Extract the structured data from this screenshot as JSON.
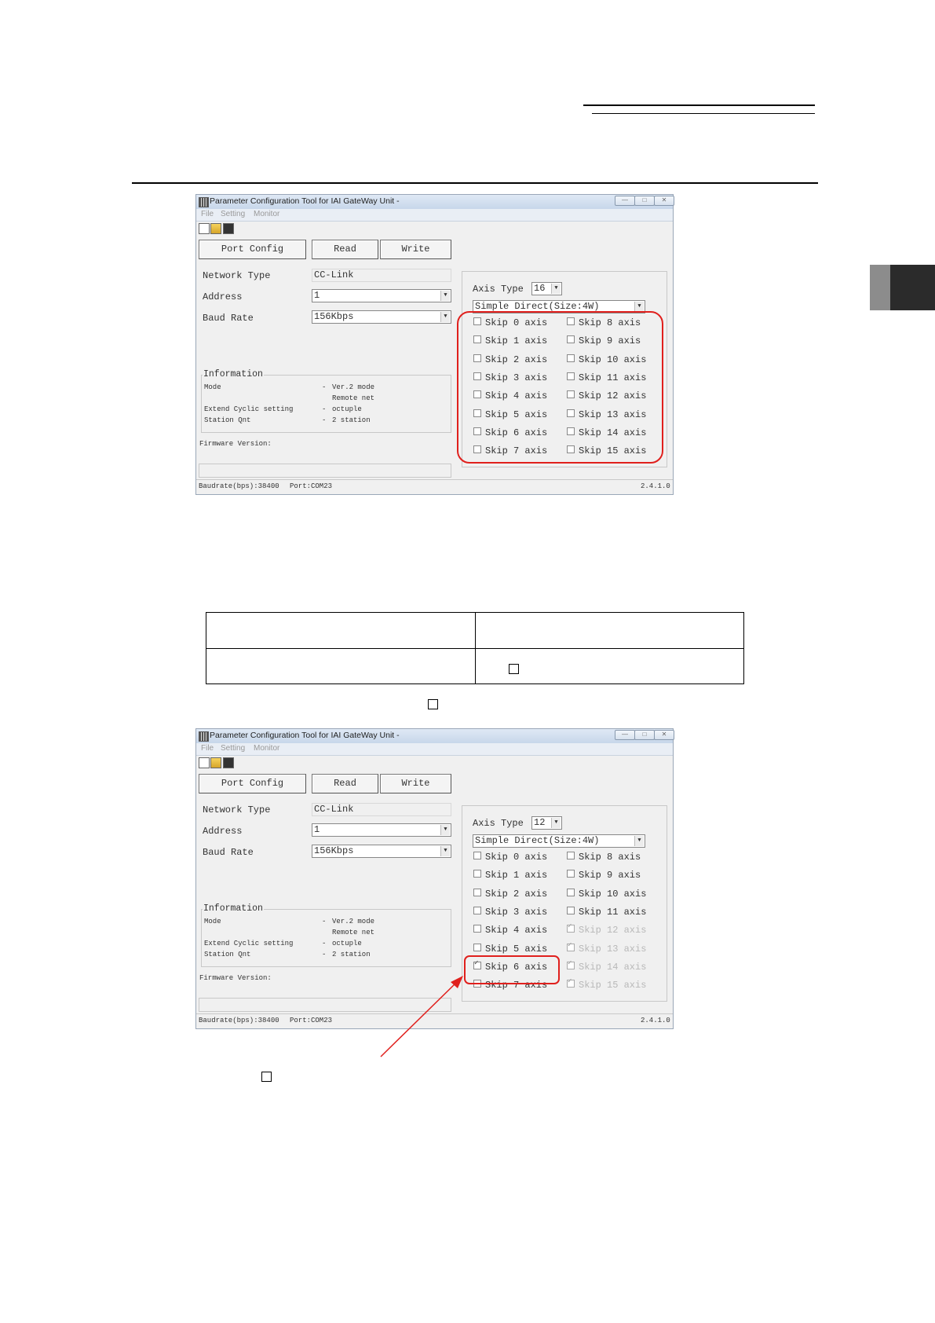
{
  "windows": [
    {
      "title": "Parameter Configuration Tool for IAI GateWay Unit -",
      "window_controls": [
        "minimize-icon",
        "maximize-icon",
        "close-icon"
      ],
      "menu": [
        "File",
        "Setting",
        "Monitor"
      ],
      "toolbar_icons": [
        "new-file-icon",
        "open-folder-icon",
        "save-icon"
      ],
      "buttons": {
        "port_config": "Port Config",
        "read": "Read",
        "write": "Write"
      },
      "network_type_label": "Network Type",
      "network_type_value": "CC-Link",
      "address_label": "Address",
      "address_value": "1",
      "baud_rate_label": "Baud Rate",
      "baud_rate_value": "156Kbps",
      "information": {
        "title": "Information",
        "rows": [
          {
            "label": "Mode",
            "dash": "-",
            "value": "Ver.2 mode"
          },
          {
            "label": "",
            "dash": "",
            "value": "Remote net"
          },
          {
            "label": "Extend Cyclic setting",
            "dash": "-",
            "value": "octuple"
          },
          {
            "label": "Station Qnt",
            "dash": "-",
            "value": "2 station"
          }
        ]
      },
      "firmware_label": "Firmware Version:",
      "axis_type_label": "Axis Type",
      "axis_type_value": "16",
      "mode_value": "Simple Direct(Size:4W)",
      "skip_axes": [
        {
          "label": "Skip 0 axis",
          "checked": false,
          "disabled": false
        },
        {
          "label": "Skip 1 axis",
          "checked": false,
          "disabled": false
        },
        {
          "label": "Skip 2 axis",
          "checked": false,
          "disabled": false
        },
        {
          "label": "Skip 3 axis",
          "checked": false,
          "disabled": false
        },
        {
          "label": "Skip 4 axis",
          "checked": false,
          "disabled": false
        },
        {
          "label": "Skip 5 axis",
          "checked": false,
          "disabled": false
        },
        {
          "label": "Skip 6 axis",
          "checked": false,
          "disabled": false
        },
        {
          "label": "Skip 7 axis",
          "checked": false,
          "disabled": false
        },
        {
          "label": "Skip 8 axis",
          "checked": false,
          "disabled": false
        },
        {
          "label": "Skip 9 axis",
          "checked": false,
          "disabled": false
        },
        {
          "label": "Skip 10 axis",
          "checked": false,
          "disabled": false
        },
        {
          "label": "Skip 11 axis",
          "checked": false,
          "disabled": false
        },
        {
          "label": "Skip 12 axis",
          "checked": false,
          "disabled": false
        },
        {
          "label": "Skip 13 axis",
          "checked": false,
          "disabled": false
        },
        {
          "label": "Skip 14 axis",
          "checked": false,
          "disabled": false
        },
        {
          "label": "Skip 15 axis",
          "checked": false,
          "disabled": false
        }
      ],
      "status_baudrate": "Baudrate(bps):38400",
      "status_port": "Port:COM23",
      "status_version": "2.4.1.0"
    },
    {
      "title": "Parameter Configuration Tool for IAI GateWay Unit -",
      "window_controls": [
        "minimize-icon",
        "maximize-icon",
        "close-icon"
      ],
      "menu": [
        "File",
        "Setting",
        "Monitor"
      ],
      "toolbar_icons": [
        "new-file-icon",
        "open-folder-icon",
        "save-icon"
      ],
      "buttons": {
        "port_config": "Port Config",
        "read": "Read",
        "write": "Write"
      },
      "network_type_label": "Network Type",
      "network_type_value": "CC-Link",
      "address_label": "Address",
      "address_value": "1",
      "baud_rate_label": "Baud Rate",
      "baud_rate_value": "156Kbps",
      "information": {
        "title": "Information",
        "rows": [
          {
            "label": "Mode",
            "dash": "-",
            "value": "Ver.2 mode"
          },
          {
            "label": "",
            "dash": "",
            "value": "Remote net"
          },
          {
            "label": "Extend Cyclic setting",
            "dash": "-",
            "value": "octuple"
          },
          {
            "label": "Station Qnt",
            "dash": "-",
            "value": "2 station"
          }
        ]
      },
      "firmware_label": "Firmware Version:",
      "axis_type_label": "Axis Type",
      "axis_type_value": "12",
      "mode_value": "Simple Direct(Size:4W)",
      "skip_axes": [
        {
          "label": "Skip 0 axis",
          "checked": false,
          "disabled": false
        },
        {
          "label": "Skip 1 axis",
          "checked": false,
          "disabled": false
        },
        {
          "label": "Skip 2 axis",
          "checked": false,
          "disabled": false
        },
        {
          "label": "Skip 3 axis",
          "checked": false,
          "disabled": false
        },
        {
          "label": "Skip 4 axis",
          "checked": false,
          "disabled": false
        },
        {
          "label": "Skip 5 axis",
          "checked": false,
          "disabled": false
        },
        {
          "label": "Skip 6 axis",
          "checked": true,
          "disabled": false
        },
        {
          "label": "Skip 7 axis",
          "checked": false,
          "disabled": false
        },
        {
          "label": "Skip 8 axis",
          "checked": false,
          "disabled": false
        },
        {
          "label": "Skip 9 axis",
          "checked": false,
          "disabled": false
        },
        {
          "label": "Skip 10 axis",
          "checked": false,
          "disabled": false
        },
        {
          "label": "Skip 11 axis",
          "checked": false,
          "disabled": false
        },
        {
          "label": "Skip 12 axis",
          "checked": true,
          "disabled": true
        },
        {
          "label": "Skip 13 axis",
          "checked": true,
          "disabled": true
        },
        {
          "label": "Skip 14 axis",
          "checked": true,
          "disabled": true
        },
        {
          "label": "Skip 15 axis",
          "checked": true,
          "disabled": true
        }
      ],
      "status_baudrate": "Baudrate(bps):38400",
      "status_port": "Port:COM23",
      "status_version": "2.4.1.0"
    }
  ],
  "colors": {
    "highlight": "#e0201d",
    "tab_dark": "#2b2b2b",
    "tab_gray": "#8c8c8c"
  }
}
